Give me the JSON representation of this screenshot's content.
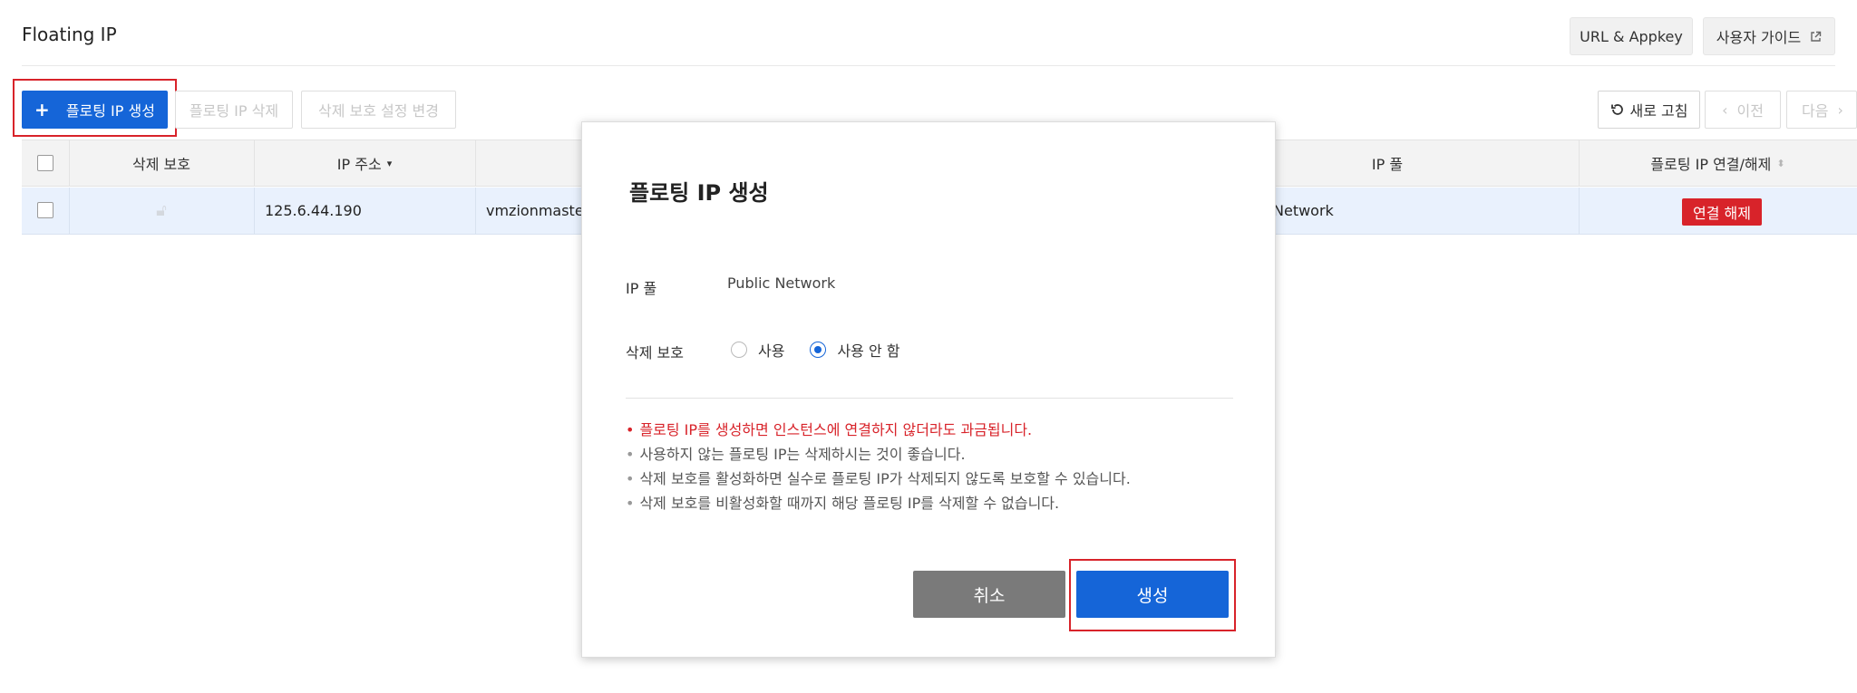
{
  "header": {
    "title": "Floating IP",
    "url_appkey_label": "URL & Appkey",
    "user_guide_label": "사용자 가이드"
  },
  "toolbar": {
    "create_label": "플로팅 IP 생성",
    "delete_label": "플로팅 IP 삭제",
    "protection_label": "삭제 보호 설정 변경",
    "refresh_label": "새로 고침",
    "prev_label": "이전",
    "next_label": "다음"
  },
  "table": {
    "columns": {
      "protection": "삭제 보호",
      "ip_address": "IP 주소",
      "ip_pool": "IP 풀",
      "connect": "플로팅 IP 연결/해제"
    },
    "rows": [
      {
        "ip_address": "125.6.44.190",
        "instance": "vmzionmaste",
        "ip_pool": "Network",
        "action": "연결 해제"
      }
    ]
  },
  "modal": {
    "title": "플로팅 IP 생성",
    "ip_pool_label": "IP 풀",
    "ip_pool_value": "Public Network",
    "protection_label": "삭제 보호",
    "option_use": "사용",
    "option_no_use": "사용 안 함",
    "selected_option": "사용 안 함",
    "notes": [
      "플로팅 IP를 생성하면 인스턴스에 연결하지 않더라도 과금됩니다.",
      "사용하지 않는 플로팅 IP는 삭제하시는 것이 좋습니다.",
      "삭제 보호를 활성화하면 실수로 플로팅 IP가 삭제되지 않도록 보호할 수 있습니다.",
      "삭제 보호를 비활성화할 때까지 해당 플로팅 IP를 삭제할 수 없습니다."
    ],
    "cancel_label": "취소",
    "create_label": "생성"
  },
  "colors": {
    "primary": "#1565d8",
    "danger": "#d8232a",
    "row_selected": "#e9f1fd"
  }
}
